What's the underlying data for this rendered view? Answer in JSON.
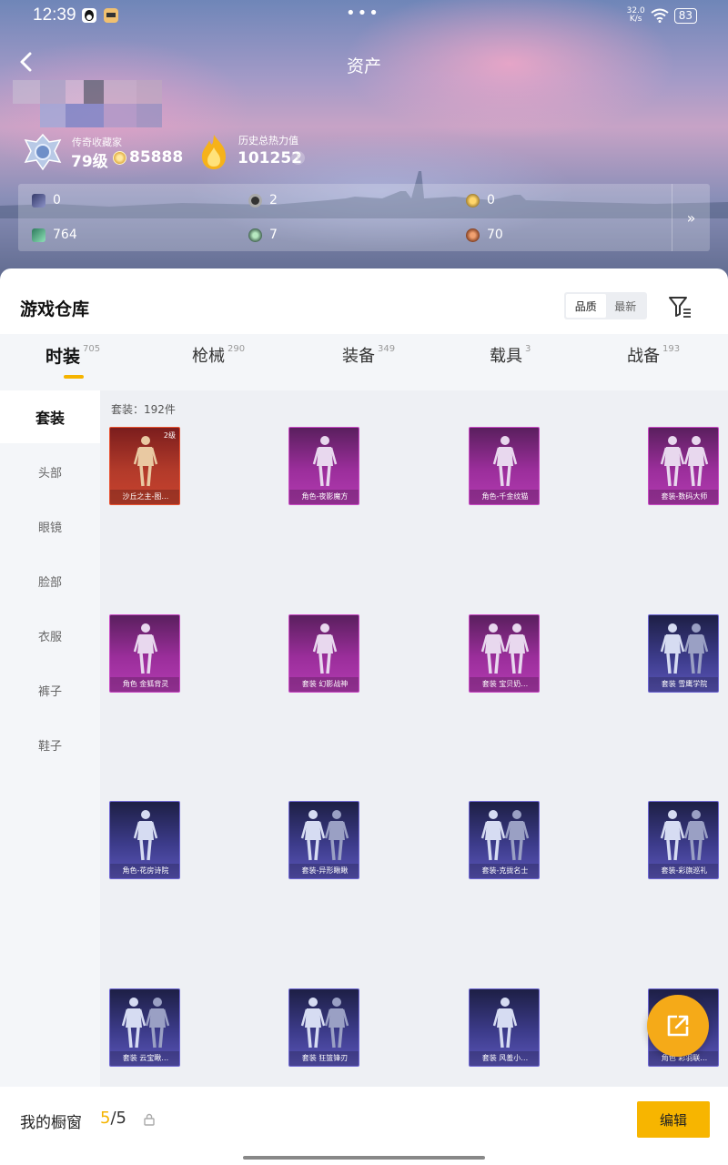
{
  "status_bar": {
    "time": "12:39",
    "more_dots": "•••",
    "net_speed_value": "32.0",
    "net_speed_unit": "K/s",
    "battery": "83"
  },
  "header": {
    "title": "资产",
    "rank_title": "传奇收藏家",
    "level": "79级",
    "coins": "85888",
    "heat_label": "历史总热力值",
    "heat_value": "101252",
    "help": "?"
  },
  "stats": [
    {
      "icon": "card-icon",
      "value": "0"
    },
    {
      "icon": "ring-icon",
      "value": "2"
    },
    {
      "icon": "gold-badge-icon",
      "value": "0"
    },
    {
      "icon": "gem-icon",
      "value": "764"
    },
    {
      "icon": "orb-icon",
      "value": "7"
    },
    {
      "icon": "bronze-orb-icon",
      "value": "70"
    }
  ],
  "stats_more": "»",
  "warehouse": {
    "title": "游戏仓库",
    "sort_options": [
      "品质",
      "最新"
    ],
    "active_sort": 0
  },
  "tabs": [
    {
      "label": "时装",
      "count": "705"
    },
    {
      "label": "枪械",
      "count": "290"
    },
    {
      "label": "装备",
      "count": "349"
    },
    {
      "label": "载具",
      "count": "3"
    },
    {
      "label": "战备",
      "count": "193"
    }
  ],
  "active_tab": 0,
  "sidebar": [
    "套装",
    "头部",
    "眼镜",
    "脸部",
    "衣服",
    "裤子",
    "鞋子"
  ],
  "active_sidebar": 0,
  "count_text": "套装：192件",
  "cards": [
    {
      "label": "沙丘之主-图…",
      "rarity": "red",
      "level": "2级"
    },
    {
      "label": "角色-夜影魔方",
      "rarity": "purple"
    },
    {
      "label": "角色-千金纹猫",
      "rarity": "purple"
    },
    {
      "label": "套装-数码大师",
      "rarity": "purple"
    },
    {
      "label": "角色 金狐背灵",
      "rarity": "purple"
    },
    {
      "label": "套装 幻影战神",
      "rarity": "purple"
    },
    {
      "label": "套装 宝贝奶…",
      "rarity": "purple"
    },
    {
      "label": "套装 雪鹰学院",
      "rarity": "blue"
    },
    {
      "label": "角色-花房诗院",
      "rarity": "blue"
    },
    {
      "label": "套装-异形瞅瞅",
      "rarity": "blue"
    },
    {
      "label": "套装-克拢名士",
      "rarity": "blue"
    },
    {
      "label": "套装-彩旗巡礼",
      "rarity": "blue"
    },
    {
      "label": "套装 云宝瞅…",
      "rarity": "blue"
    },
    {
      "label": "套装 狂篮锋刃",
      "rarity": "blue"
    },
    {
      "label": "套装 风羞小…",
      "rarity": "blue"
    },
    {
      "label": "角色 彩羽联…",
      "rarity": "blue"
    }
  ],
  "bottom": {
    "showcase_label": "我的橱窗",
    "showcase_used": "5",
    "showcase_total": "/5",
    "edit_label": "编辑"
  }
}
